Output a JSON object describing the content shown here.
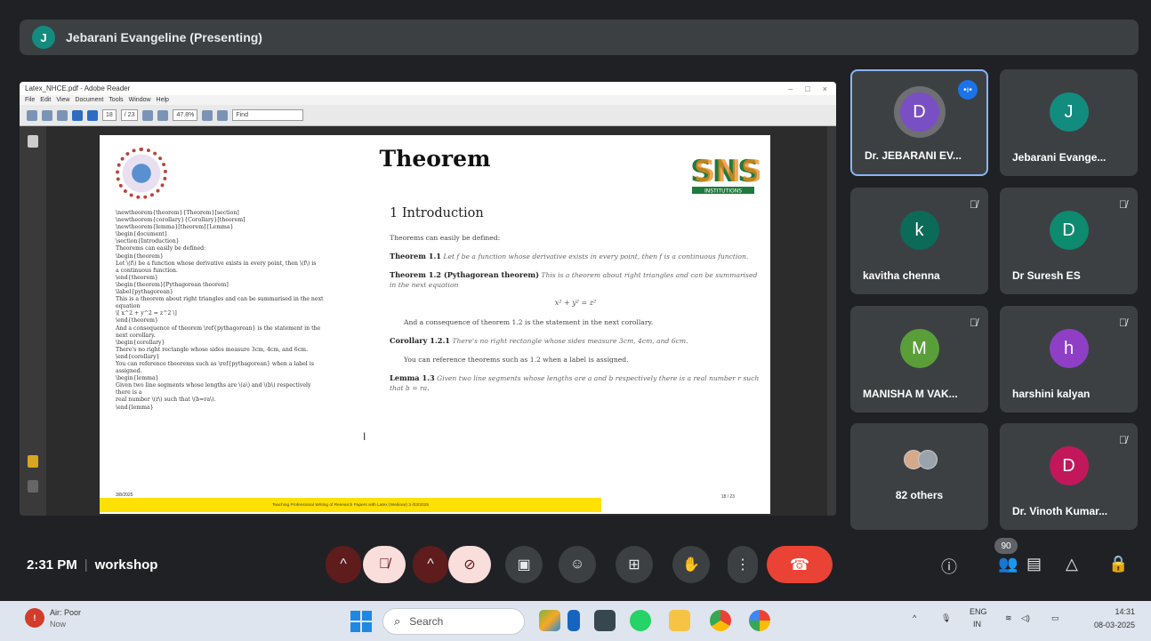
{
  "presenting": {
    "avatar_letter": "J",
    "title": "Jebarani Evangeline (Presenting)"
  },
  "shared_screen": {
    "window_title": "Latex_NHCE.pdf - Adobe Reader",
    "menu": [
      "File",
      "Edit",
      "View",
      "Document",
      "Tools",
      "Window",
      "Help"
    ],
    "page_field": "18",
    "page_total": "/ 23",
    "zoom": "47.8%",
    "find_placeholder": "Find",
    "page": {
      "title": "Theorem",
      "right_logo_text": "SNS",
      "right_logo_sub": "INSTITUTIONS",
      "code_lines": [
        "\\newtheorem{theorem}{Theorem}[section]",
        "\\newtheorem{corollary}{Corollary}[theorem]",
        "\\newtheorem{lemma}[theorem]{Lemma}",
        "\\begin{document}",
        "\\section{Introduction}",
        "Theorems can easily be defined:",
        "\\begin{theorem}",
        "Let \\(f\\) be a function whose derivative exists in every point, then \\(f\\) is",
        "a continuous function.",
        "\\end{theorem}",
        "\\begin{theorem}[Pythagorean theorem]",
        "\\label{pythagorean}",
        "This is a theorem about right triangles and can be summarised in the next",
        "equation",
        "\\[ x^2 + y^2 = z^2 \\]",
        "\\end{theorem}",
        "And a consequence of theorem \\ref{pythagorean} is the statement in the",
        "next corollary.",
        "\\begin{corollary}",
        "There's no right rectangle whose sides measure 3cm, 4cm, and 6cm.",
        "\\end{corollary}",
        "You can reference theorems such as \\ref{pythagorean} when a label is",
        "assigned.",
        "\\begin{lemma}",
        "Given two line segments whose lengths are \\(a\\) and \\(b\\) respectively",
        "there is a",
        "real number \\(r\\) such that \\(b=ra\\).",
        "\\end{lemma}"
      ],
      "code_footer": "3/8/2025",
      "section_title": "1   Introduction",
      "intro": "Theorems can easily be defined:",
      "thm1_head": "Theorem 1.1",
      "thm1_body": "Let f be a function whose derivative exists in every point, then f is a continuous function.",
      "thm2_head": "Theorem 1.2 (Pythagorean theorem)",
      "thm2_body": "This is a theorem about right triangles and can be summarised in the next equation",
      "equation": "x² + y² = z²",
      "consequence": "And a consequence of theorem 1.2 is the statement in the next corollary.",
      "cor_head": "Corollary 1.2.1",
      "cor_body": "There's no right rectangle whose sides measure 3cm, 4cm, and 6cm.",
      "reference": "You can reference theorems such as 1.2 when a label is assigned.",
      "lemma_head": "Lemma 1.3",
      "lemma_body": "Given two line segments whose lengths are a and b respectively there is a real number r such that b = ra.",
      "footer_text": "Teaching Professional Writing of Research Papers with Latex (Webinar) 3 /03/2025",
      "page_number": "18 / 23"
    }
  },
  "participants": [
    {
      "letter": "D",
      "name": "Dr. JEBARANI EV...",
      "color": "#7b4fc4",
      "speaking": true
    },
    {
      "letter": "J",
      "name": "Jebarani Evange...",
      "color": "#128c7e"
    },
    {
      "letter": "k",
      "name": "kavitha chenna",
      "color": "#0b6b58",
      "muted": true
    },
    {
      "letter": "D",
      "name": "Dr Suresh ES",
      "color": "#0e8a6f",
      "muted": true
    },
    {
      "letter": "M",
      "name": "MANISHA M VAK...",
      "color": "#5a9e3a",
      "muted": true
    },
    {
      "letter": "h",
      "name": "harshini kalyan",
      "color": "#8e3fc6",
      "muted": true
    },
    {
      "letter": "D",
      "name": "Dr. Vinoth Kumar...",
      "color": "#c2185b",
      "muted": true
    }
  ],
  "others_label": "82 others",
  "bottom": {
    "time": "2:31 PM",
    "meeting_name": "workshop",
    "people_badge": "90"
  },
  "taskbar": {
    "weather_title": "Air: Poor",
    "weather_sub": "Now",
    "search_placeholder": "Search",
    "lang1": "ENG",
    "lang2": "IN",
    "time": "14:31",
    "date": "08-03-2025"
  }
}
